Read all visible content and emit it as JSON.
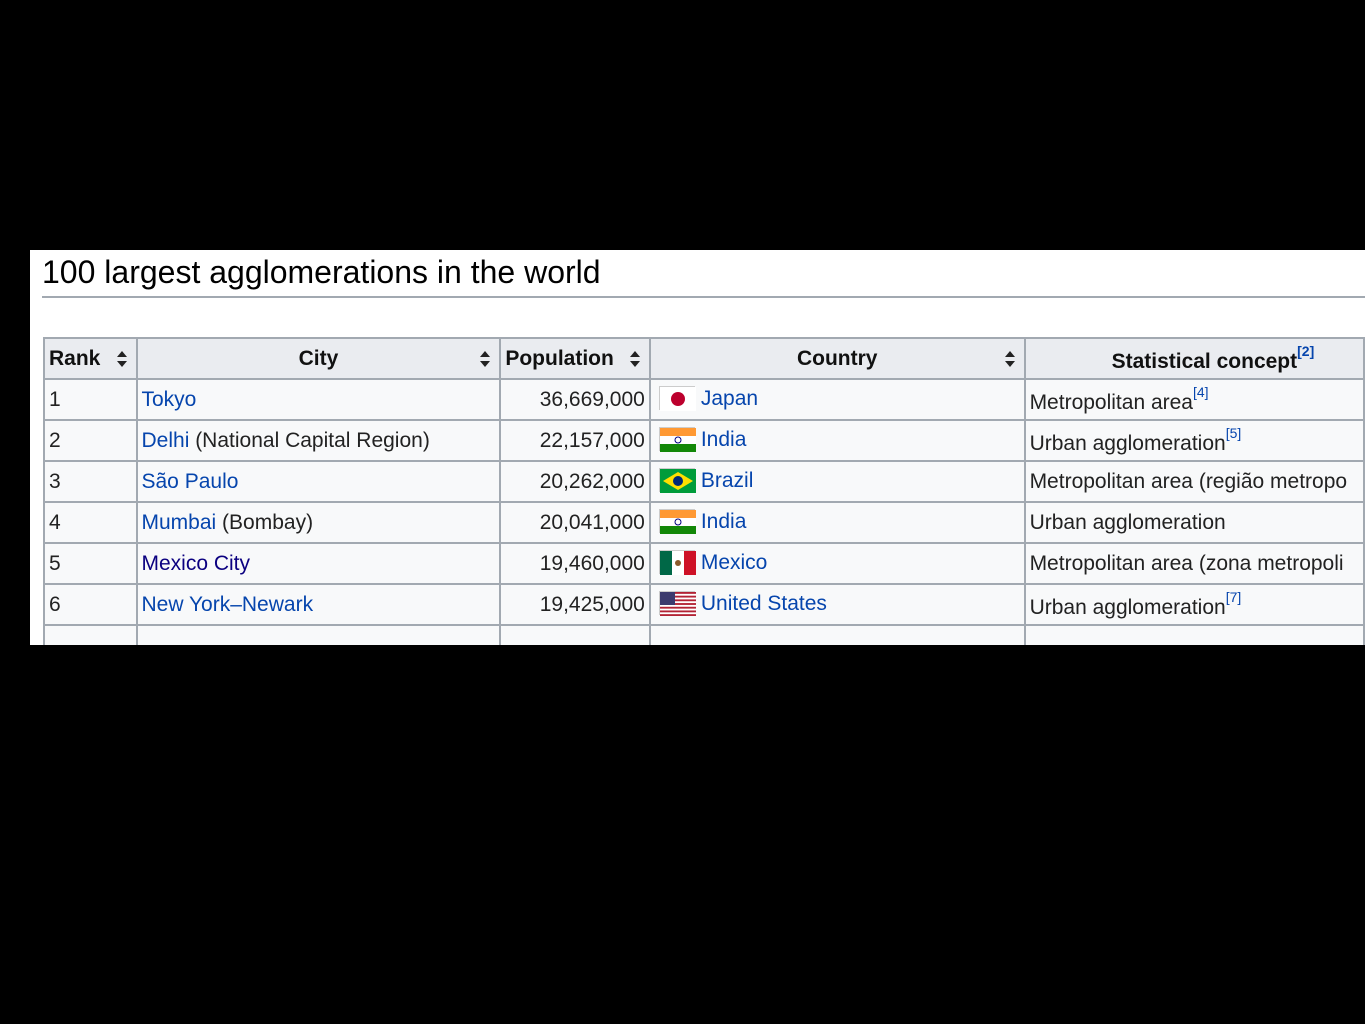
{
  "title": "100 largest agglomerations in the world",
  "columns": {
    "rank": "Rank",
    "city": "City",
    "population": "Population",
    "country": "Country",
    "concept": "Statistical concept",
    "concept_ref": "[2]"
  },
  "rows": [
    {
      "rank": "1",
      "city": "Tokyo",
      "city_extra": "",
      "population": "36,669,000",
      "country": "Japan",
      "flag": "japan-flag",
      "concept": "Metropolitan area",
      "ref": "[4]"
    },
    {
      "rank": "2",
      "city": "Delhi",
      "city_extra": " (National Capital Region)",
      "population": "22,157,000",
      "country": "India",
      "flag": "india-flag",
      "concept": "Urban agglomeration",
      "ref": "[5]"
    },
    {
      "rank": "3",
      "city": "São Paulo",
      "city_extra": "",
      "population": "20,262,000",
      "country": "Brazil",
      "flag": "brazil-flag",
      "concept": "Metropolitan area (região metropo",
      "ref": ""
    },
    {
      "rank": "4",
      "city": "Mumbai",
      "city_extra": " (Bombay)",
      "population": "20,041,000",
      "country": "India",
      "flag": "india-flag",
      "concept": "Urban agglomeration",
      "ref": ""
    },
    {
      "rank": "5",
      "city": "Mexico City",
      "city_extra": "",
      "population": "19,460,000",
      "country": "Mexico",
      "flag": "mexico-flag",
      "concept": "Metropolitan area (zona metropoli",
      "ref": ""
    },
    {
      "rank": "6",
      "city": "New York–Newark",
      "city_extra": "",
      "population": "19,425,000",
      "country": "United States",
      "flag": "usa-flag",
      "concept": "Urban agglomeration",
      "ref": "[7]"
    }
  ],
  "colors": {
    "link": "#0645ad",
    "visited_link": "#0b0080",
    "header_bg": "#eaecf0",
    "cell_bg": "#f8f9fa",
    "border": "#a2a9b1"
  }
}
